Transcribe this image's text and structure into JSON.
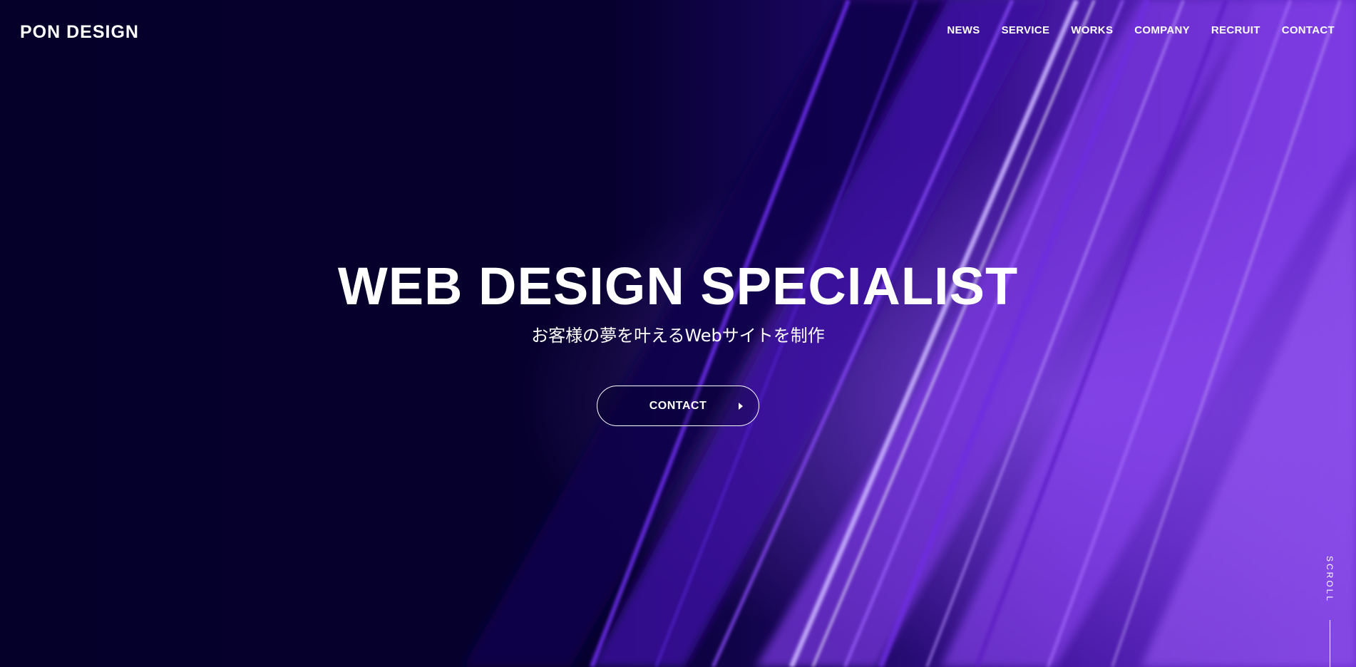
{
  "header": {
    "logo": "PON DESIGN",
    "nav": [
      {
        "label": "NEWS"
      },
      {
        "label": "SERVICE"
      },
      {
        "label": "WORKS"
      },
      {
        "label": "COMPANY"
      },
      {
        "label": "RECRUIT"
      },
      {
        "label": "CONTACT"
      }
    ]
  },
  "hero": {
    "title": "WEB DESIGN SPECIALIST",
    "subtitle": "お客様の夢を叶えるWebサイトを制作",
    "cta_label": "CONTACT",
    "cta_icon": "caret-right-icon",
    "scroll_label": "SCROLL"
  },
  "colors": {
    "background": "#05002a",
    "accent_purple": "#7b2fe0",
    "highlight_violet": "#b58bff",
    "text": "#ffffff"
  }
}
